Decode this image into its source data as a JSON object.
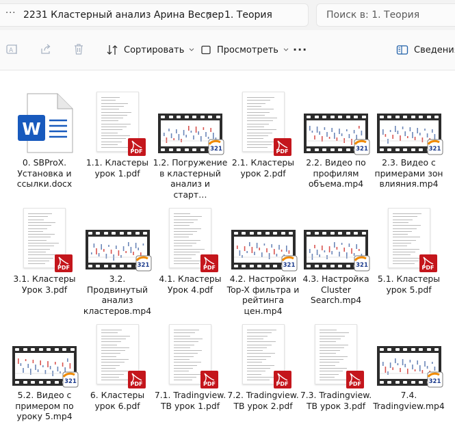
{
  "address": {
    "more_label": "···",
    "crumbs": [
      "2231 Кластерный анализ Арина Веспер",
      "1. Теория"
    ]
  },
  "search": {
    "placeholder": "Поиск в: 1. Теория"
  },
  "toolbar": {
    "sort_label": "Сортировать",
    "view_label": "Просмотреть",
    "more_label": "···",
    "details_label": "Сведения"
  },
  "files": [
    {
      "name": "0. SBProX. Установка и ссылки.docx",
      "type": "docx"
    },
    {
      "name": "1.1. Кластеры урок 1.pdf",
      "type": "pdf"
    },
    {
      "name": "1.2. Погружение в кластерный анализ и старт…",
      "type": "mp4"
    },
    {
      "name": "2.1. Кластеры урок 2.pdf",
      "type": "pdf"
    },
    {
      "name": "2.2. Видео по профилям объема.mp4",
      "type": "mp4"
    },
    {
      "name": "2.3. Видео с примерами зон влияния.mp4",
      "type": "mp4"
    },
    {
      "name": "3.1. Кластеры Урок 3.pdf",
      "type": "pdf"
    },
    {
      "name": "3.2. Продвинутый анализ кластеров.mp4",
      "type": "mp4"
    },
    {
      "name": "4.1. Кластеры Урок 4.pdf",
      "type": "pdf"
    },
    {
      "name": "4.2. Настройки Top-X фильтра и рейтинга цен.mp4",
      "type": "mp4"
    },
    {
      "name": "4.3. Настройка Cluster Search.mp4",
      "type": "mp4"
    },
    {
      "name": "5.1. Кластеры урок 5.pdf",
      "type": "pdf"
    },
    {
      "name": "5.2. Видео с примером по уроку 5.mp4",
      "type": "mp4"
    },
    {
      "name": "6. Кластеры урок 6.pdf",
      "type": "pdf"
    },
    {
      "name": "7.1. Tradingview. ТВ урок 1.pdf",
      "type": "pdf"
    },
    {
      "name": "7.2. Tradingview. ТВ урок 2.pdf",
      "type": "pdf"
    },
    {
      "name": "7.3. Tradingview. ТВ урок 3.pdf",
      "type": "pdf"
    },
    {
      "name": "7.4. Tradingview.mp4",
      "type": "mp4"
    }
  ],
  "badges": {
    "pdf_text": "PDF",
    "player_text": "321"
  },
  "colors": {
    "word_blue": "#185abd",
    "pdf_red": "#c4161c",
    "film_dark": "#2c2c2c",
    "player_orange": "#f08a00"
  }
}
